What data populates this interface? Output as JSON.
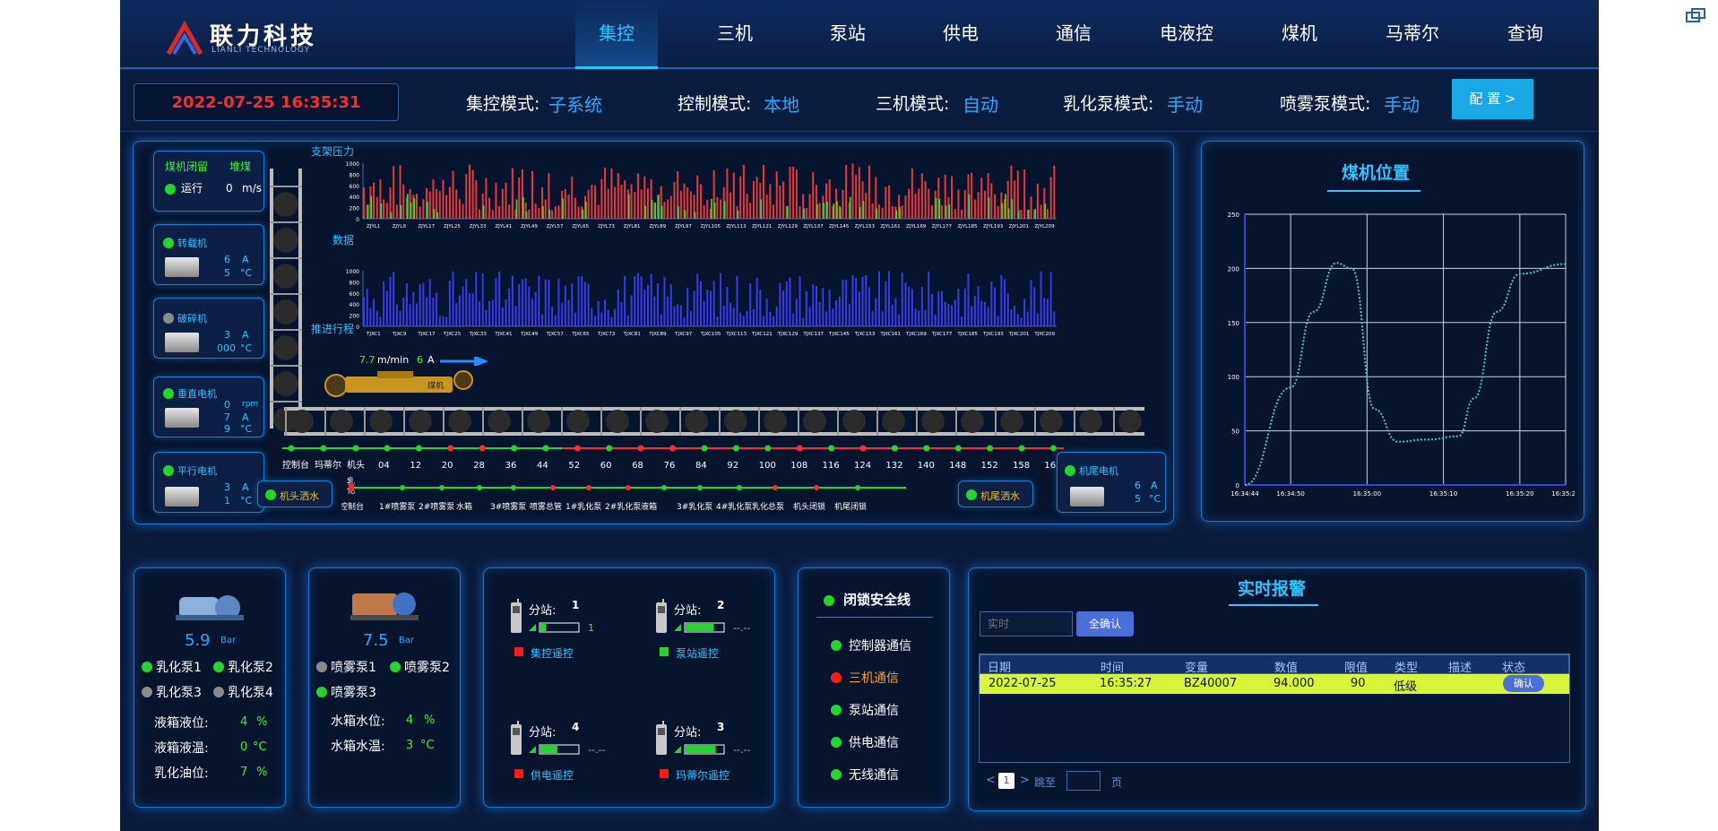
{
  "logo": {
    "cn": "联力科技",
    "en": "LIANLI TECHNOLOGY"
  },
  "nav": [
    "集控",
    "三机",
    "泵站",
    "供电",
    "通信",
    "电液控",
    "煤机",
    "马蒂尔",
    "查询"
  ],
  "datetime": "2022-07-25 16:35:31",
  "modes": [
    {
      "label": "集控模式:",
      "value": "子系统"
    },
    {
      "label": "控制模式:",
      "value": "本地"
    },
    {
      "label": "三机模式:",
      "value": "自动"
    },
    {
      "label": "乳化泵模式:",
      "value": "手动"
    },
    {
      "label": "喷雾泵模式:",
      "value": "手动"
    }
  ],
  "config_button": "配 置 >",
  "left_devices": {
    "coal": {
      "l1": "煤机闭留",
      "l2": "堆煤",
      "run": "运行",
      "speed": "0",
      "unit": "m/s"
    },
    "zhuanzai": {
      "name": "转载机",
      "v1": "6",
      "u1": "A",
      "v2": "5",
      "u2": "°C"
    },
    "posui": {
      "name": "破碎机",
      "v1": "3",
      "u1": "A",
      "v2": "000",
      "u2": "°C"
    },
    "chuizhi": {
      "name": "垂直电机",
      "v1": "0",
      "u1": "rpm",
      "v2": "7",
      "u2": "A",
      "v3": "9",
      "u3": "°C"
    },
    "pingxing": {
      "name": "平行电机",
      "v1": "3",
      "u1": "A",
      "v2": "1",
      "u2": "°C"
    }
  },
  "chart_labels": {
    "pressure": "支架压力",
    "data": "数据",
    "push": "推进行程",
    "speed": "7.7",
    "speed_unit": "m/min",
    "current": "6",
    "current_unit": "A"
  },
  "top_chart": {
    "xticks": [
      "ZJYL1",
      "ZJYL9",
      "ZJYL17",
      "ZJYL25",
      "ZJYL33",
      "ZJYL41",
      "ZJYL49",
      "ZJYL57",
      "ZJYL65",
      "ZJYL73",
      "ZJYL81",
      "ZJYL89",
      "ZJYL97",
      "ZJYL105",
      "ZJYL113",
      "ZJYL121",
      "ZJYL129",
      "ZJYL137",
      "ZJYL145",
      "ZJYL153",
      "ZJYL161",
      "ZJYL169",
      "ZJYL177",
      "ZJYL185",
      "ZJYL193",
      "ZJYL201",
      "ZJYL209"
    ],
    "yticks": [
      "1000",
      "800",
      "600",
      "400",
      "200",
      "0"
    ]
  },
  "mid_chart": {
    "xticks": [
      "TJXC1",
      "TJXC9",
      "TJXC17",
      "TJXC25",
      "TJXC33",
      "TJXC41",
      "TJXC49",
      "TJXC57",
      "TJXC65",
      "TJXC73",
      "TJXC81",
      "TJXC89",
      "TJXC97",
      "TJXC105",
      "TJXC113",
      "TJXC121",
      "TJXC129",
      "TJXC137",
      "TJXC145",
      "TJXC153",
      "TJXC161",
      "TJXC169",
      "TJXC177",
      "TJXC185",
      "TJXC193",
      "TJXC201",
      "TJXC209"
    ],
    "yticks": [
      "1000",
      "800",
      "600",
      "400",
      "200",
      "0"
    ]
  },
  "shearer_label": "煤机",
  "scale_top": [
    "控制台",
    "玛蒂尔",
    "机头",
    "04",
    "12",
    "20",
    "28",
    "36",
    "44",
    "52",
    "60",
    "68",
    "76",
    "84",
    "92",
    "100",
    "108",
    "116",
    "124",
    "132",
    "140",
    "148",
    "152",
    "158",
    "162"
  ],
  "scale_bottom": [
    "控制台",
    "1#喷雾泵",
    "2#喷雾泵",
    "水箱",
    "3#喷雾泵",
    "喷雾总管",
    "1#乳化泵",
    "2#乳化泵",
    "液箱",
    "3#乳化泵",
    "4#乳化泵",
    "乳化总泵",
    "机头闭锁",
    "机尾闭锁"
  ],
  "spray": {
    "head": "机头洒水",
    "tail": "机尾洒水",
    "ru": "乳",
    "hua": "化"
  },
  "tail_motor": {
    "name": "机尾电机",
    "v1": "6",
    "u1": "A",
    "v2": "5",
    "u2": "°C"
  },
  "position_chart_title": "煤机位置",
  "chart_data": {
    "type": "line",
    "title": "煤机位置",
    "x": [
      "16:34:44",
      "16:34:50",
      "16:35:00",
      "16:35:10",
      "16:35:20",
      "16:35:26"
    ],
    "yticks": [
      "250",
      "200",
      "150",
      "100",
      "50",
      "0"
    ],
    "ylim": [
      0,
      250
    ],
    "series": [
      {
        "values": [
          [
            0,
            0
          ],
          [
            6,
            90
          ],
          [
            9,
            160
          ],
          [
            12,
            205
          ],
          [
            14,
            200
          ],
          [
            17,
            70
          ],
          [
            20,
            40
          ],
          [
            24,
            42
          ],
          [
            28,
            45
          ],
          [
            30,
            80
          ],
          [
            33,
            160
          ],
          [
            36,
            195
          ],
          [
            42,
            204
          ]
        ]
      }
    ]
  },
  "pump1": {
    "value": "5.9",
    "unit": "Bar",
    "items": [
      "乳化泵1",
      "乳化泵2",
      "乳化泵3",
      "乳化泵4"
    ],
    "rows": [
      {
        "label": "液箱液位:",
        "value": "4",
        "unit": "%"
      },
      {
        "label": "液箱液温:",
        "value": "0",
        "unit": "°C"
      },
      {
        "label": "乳化油位:",
        "value": "7",
        "unit": "%"
      }
    ]
  },
  "pump2": {
    "value": "7.5",
    "unit": "Bar",
    "items": [
      "喷雾泵1",
      "喷雾泵2",
      "喷雾泵3"
    ],
    "rows": [
      {
        "label": "水箱水位:",
        "value": "4",
        "unit": "%"
      },
      {
        "label": "水箱水温:",
        "value": "3",
        "unit": "°C"
      }
    ]
  },
  "stations": [
    {
      "label": "分站:",
      "num": "1",
      "val": "1",
      "ctrl": "集控遥控"
    },
    {
      "label": "分站:",
      "num": "2",
      "val": "--.--",
      "ctrl": "泵站遥控"
    },
    {
      "label": "分站:",
      "num": "4",
      "val": "--.--",
      "ctrl": "供电遥控"
    },
    {
      "label": "分站:",
      "num": "3",
      "val": "--.--",
      "ctrl": "玛蒂尔遥控"
    }
  ],
  "safety": {
    "title": "闭锁安全线",
    "items": [
      "控制器通信",
      "三机通信",
      "泵站通信",
      "供电通信",
      "无线通信"
    ]
  },
  "alarm": {
    "title": "实时报警",
    "input_placeholder": "实时",
    "confirm_all": "全确认",
    "headers": [
      "日期",
      "时间",
      "变量",
      "数值",
      "限值",
      "类型",
      "描述",
      "状态"
    ],
    "rows": [
      [
        "2022-07-25",
        "16:35:27",
        "BZ40007",
        "94.000",
        "90",
        "低级",
        ""
      ]
    ],
    "confirm": "确认",
    "pager": {
      "prev": "<",
      "page": "1",
      "next": ">",
      "goto": "跳至",
      "page_unit": "页"
    }
  },
  "colors": {
    "accent": "#2fc3ff",
    "alarm_row": "#d7f53a",
    "green": "#22d62a",
    "red": "#ff1a1a"
  }
}
